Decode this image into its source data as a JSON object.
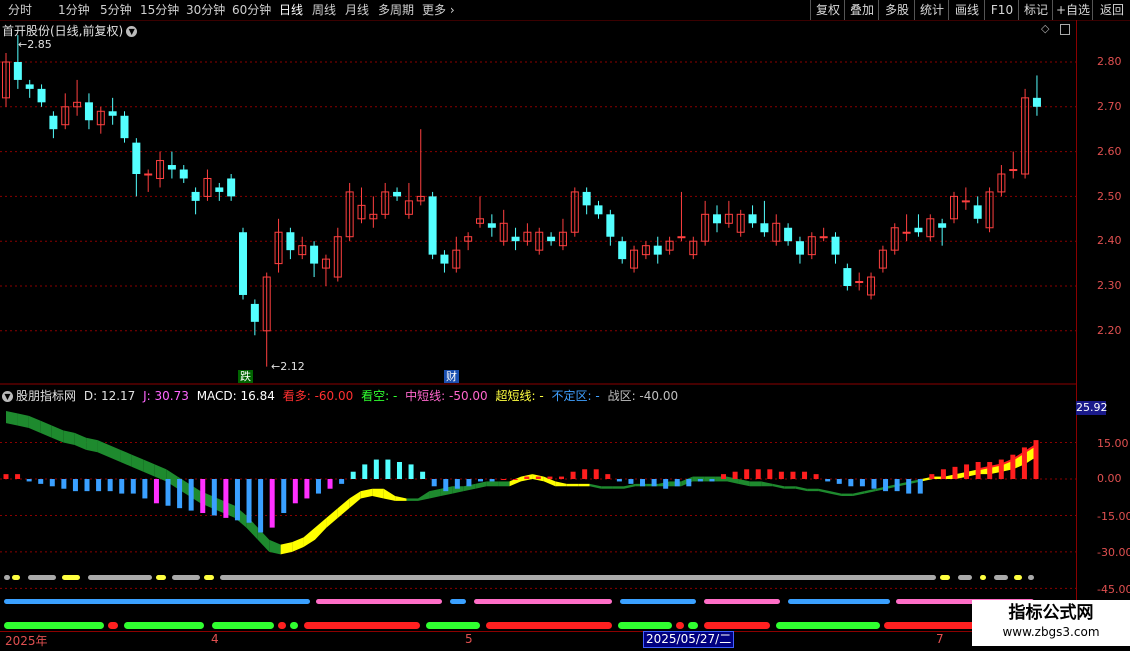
{
  "toolbar": {
    "periods": [
      "分时",
      "1分钟",
      "5分钟",
      "15分钟",
      "30分钟",
      "60分钟",
      "日线",
      "周线",
      "月线",
      "多周期",
      "更多"
    ],
    "active_period": "日线",
    "right_buttons": [
      "复权",
      "叠加",
      "多股",
      "统计",
      "画线",
      "F10",
      "标记",
      "+自选",
      "返回"
    ]
  },
  "chart": {
    "title": "首开股份(日线,前复权)",
    "high_label": "2.85",
    "low_label": "2.12",
    "marker_die": "跌",
    "marker_cai": "财"
  },
  "indicator": {
    "name": "股朋指标网",
    "d": "D: 12.17",
    "j": "J: 30.73",
    "macd": "MACD: 16.84",
    "kanduo": "看多: -60.00",
    "kankong": "看空: -",
    "zhongduan": "中短线: -50.00",
    "chaoduan": "超短线: -",
    "buding": "不定区: -",
    "zhanqu": "战区: -40.00",
    "current_value": "25.92"
  },
  "axis": {
    "price_ticks": [
      "2.80",
      "2.70",
      "2.60",
      "2.50",
      "2.40",
      "2.30",
      "2.20"
    ],
    "ind_ticks": [
      "15.00",
      "0.00",
      "-15.00",
      "-30.00",
      "-45.00"
    ]
  },
  "dates": {
    "labels": [
      "2025年",
      "4",
      "5",
      "7"
    ],
    "selected": "2025/05/27/二"
  },
  "watermark": {
    "line1": "指标公式网",
    "line2": "www.zbgs3.com"
  },
  "colors": {
    "up": "#ff4040",
    "down": "#54ffff",
    "grid": "#8b0000",
    "macd_pos": "#ff1e1e",
    "macd_neg_blue": "#3aa0ff",
    "macd_neg_mag": "#ff30ff",
    "band_green": "#1e8a2e",
    "band_yellow": "#ffff00"
  },
  "chart_data": {
    "type": "candlestick",
    "candles": [
      [
        2.72,
        2.8,
        2.7,
        2.82
      ],
      [
        2.8,
        2.76,
        2.74,
        2.86
      ],
      [
        2.75,
        2.74,
        2.72,
        2.76
      ],
      [
        2.74,
        2.71,
        2.7,
        2.75
      ],
      [
        2.68,
        2.65,
        2.63,
        2.69
      ],
      [
        2.66,
        2.7,
        2.65,
        2.73
      ],
      [
        2.7,
        2.71,
        2.68,
        2.76
      ],
      [
        2.71,
        2.67,
        2.65,
        2.73
      ],
      [
        2.66,
        2.69,
        2.64,
        2.7
      ],
      [
        2.69,
        2.68,
        2.66,
        2.72
      ],
      [
        2.68,
        2.63,
        2.62,
        2.69
      ],
      [
        2.62,
        2.55,
        2.5,
        2.63
      ],
      [
        2.55,
        2.55,
        2.51,
        2.56
      ],
      [
        2.54,
        2.58,
        2.52,
        2.6
      ],
      [
        2.57,
        2.56,
        2.54,
        2.6
      ],
      [
        2.56,
        2.54,
        2.53,
        2.57
      ],
      [
        2.51,
        2.49,
        2.46,
        2.52
      ],
      [
        2.5,
        2.54,
        2.49,
        2.56
      ],
      [
        2.52,
        2.51,
        2.49,
        2.53
      ],
      [
        2.54,
        2.5,
        2.49,
        2.55
      ],
      [
        2.42,
        2.28,
        2.27,
        2.43
      ],
      [
        2.26,
        2.22,
        2.19,
        2.27
      ],
      [
        2.2,
        2.32,
        2.12,
        2.33
      ],
      [
        2.35,
        2.42,
        2.33,
        2.45
      ],
      [
        2.42,
        2.38,
        2.36,
        2.43
      ],
      [
        2.37,
        2.39,
        2.36,
        2.41
      ],
      [
        2.39,
        2.35,
        2.32,
        2.4
      ],
      [
        2.34,
        2.36,
        2.3,
        2.37
      ],
      [
        2.32,
        2.41,
        2.31,
        2.43
      ],
      [
        2.41,
        2.51,
        2.4,
        2.53
      ],
      [
        2.45,
        2.48,
        2.44,
        2.52
      ],
      [
        2.45,
        2.46,
        2.43,
        2.5
      ],
      [
        2.46,
        2.51,
        2.45,
        2.53
      ],
      [
        2.51,
        2.5,
        2.49,
        2.52
      ],
      [
        2.46,
        2.49,
        2.45,
        2.53
      ],
      [
        2.49,
        2.5,
        2.48,
        2.65
      ],
      [
        2.5,
        2.37,
        2.36,
        2.51
      ],
      [
        2.37,
        2.35,
        2.33,
        2.38
      ],
      [
        2.34,
        2.38,
        2.33,
        2.41
      ],
      [
        2.4,
        2.41,
        2.38,
        2.42
      ],
      [
        2.44,
        2.45,
        2.43,
        2.5
      ],
      [
        2.44,
        2.43,
        2.41,
        2.46
      ],
      [
        2.4,
        2.44,
        2.39,
        2.47
      ],
      [
        2.41,
        2.4,
        2.38,
        2.43
      ],
      [
        2.4,
        2.42,
        2.39,
        2.44
      ],
      [
        2.38,
        2.42,
        2.37,
        2.43
      ],
      [
        2.41,
        2.4,
        2.39,
        2.42
      ],
      [
        2.39,
        2.42,
        2.38,
        2.45
      ],
      [
        2.42,
        2.51,
        2.41,
        2.52
      ],
      [
        2.51,
        2.48,
        2.46,
        2.52
      ],
      [
        2.48,
        2.46,
        2.45,
        2.49
      ],
      [
        2.46,
        2.41,
        2.39,
        2.47
      ],
      [
        2.4,
        2.36,
        2.35,
        2.41
      ],
      [
        2.34,
        2.38,
        2.33,
        2.39
      ],
      [
        2.37,
        2.39,
        2.36,
        2.4
      ],
      [
        2.39,
        2.37,
        2.35,
        2.41
      ],
      [
        2.38,
        2.4,
        2.37,
        2.41
      ],
      [
        2.41,
        2.41,
        2.4,
        2.51
      ],
      [
        2.37,
        2.4,
        2.36,
        2.41
      ],
      [
        2.4,
        2.46,
        2.39,
        2.49
      ],
      [
        2.46,
        2.44,
        2.42,
        2.48
      ],
      [
        2.44,
        2.46,
        2.43,
        2.49
      ],
      [
        2.42,
        2.46,
        2.41,
        2.47
      ],
      [
        2.46,
        2.44,
        2.43,
        2.48
      ],
      [
        2.44,
        2.42,
        2.41,
        2.49
      ],
      [
        2.4,
        2.44,
        2.39,
        2.46
      ],
      [
        2.43,
        2.4,
        2.39,
        2.44
      ],
      [
        2.4,
        2.37,
        2.35,
        2.41
      ],
      [
        2.37,
        2.41,
        2.36,
        2.42
      ],
      [
        2.41,
        2.41,
        2.4,
        2.43
      ],
      [
        2.41,
        2.37,
        2.35,
        2.42
      ],
      [
        2.34,
        2.3,
        2.29,
        2.35
      ],
      [
        2.31,
        2.31,
        2.29,
        2.33
      ],
      [
        2.28,
        2.32,
        2.27,
        2.33
      ],
      [
        2.34,
        2.38,
        2.33,
        2.39
      ],
      [
        2.38,
        2.43,
        2.37,
        2.44
      ],
      [
        2.42,
        2.42,
        2.4,
        2.46
      ],
      [
        2.43,
        2.42,
        2.41,
        2.46
      ],
      [
        2.41,
        2.45,
        2.4,
        2.46
      ],
      [
        2.44,
        2.43,
        2.39,
        2.45
      ],
      [
        2.45,
        2.5,
        2.44,
        2.51
      ],
      [
        2.49,
        2.49,
        2.47,
        2.52
      ],
      [
        2.48,
        2.45,
        2.44,
        2.5
      ],
      [
        2.43,
        2.51,
        2.42,
        2.52
      ],
      [
        2.51,
        2.55,
        2.5,
        2.57
      ],
      [
        2.56,
        2.56,
        2.54,
        2.6
      ],
      [
        2.55,
        2.72,
        2.54,
        2.74
      ],
      [
        2.72,
        2.7,
        2.68,
        2.77
      ]
    ],
    "macd": [
      2,
      2,
      -1,
      -2,
      -3,
      -4,
      -5,
      -5,
      -5,
      -5,
      -6,
      -6,
      -8,
      -10,
      -11,
      -12,
      -13,
      -14,
      -15,
      -16,
      -17,
      -18,
      -22,
      -20,
      -14,
      -10,
      -8,
      -6,
      -4,
      -2,
      3,
      6,
      8,
      8,
      7,
      6,
      3,
      -3,
      -5,
      -4,
      -3,
      -1,
      -1,
      0,
      0,
      1,
      1,
      1,
      1,
      3,
      4,
      4,
      2,
      -1,
      -2,
      -3,
      -3,
      -4,
      -3,
      -3,
      -1,
      -1,
      2,
      3,
      4,
      4,
      4,
      3,
      3,
      3,
      2,
      -1,
      -2,
      -3,
      -3,
      -4,
      -5,
      -5,
      -6,
      -6,
      2,
      4,
      5,
      6,
      7,
      7,
      8,
      10,
      13,
      16
    ],
    "band_a": [
      28,
      27,
      26,
      24,
      22,
      20,
      19,
      17,
      16,
      14,
      12,
      10,
      8,
      6,
      4,
      1,
      -2,
      -5,
      -7,
      -9,
      -11,
      -15,
      -20,
      -25,
      -27,
      -26,
      -24,
      -20,
      -16,
      -12,
      -8,
      -5,
      -4,
      -4,
      -7,
      -8,
      -8,
      -5,
      -4,
      -3,
      -3,
      -2,
      -1,
      -1,
      -1,
      1,
      2,
      1,
      -1,
      -2,
      -2,
      -2,
      -3,
      -3,
      -3,
      -2,
      -2,
      -2,
      -1,
      -1,
      1,
      1,
      1,
      1,
      0,
      -1,
      -1,
      -2,
      -3,
      -3,
      -4,
      -4,
      -5,
      -6,
      -6,
      -5,
      -4,
      -3,
      -2,
      -1,
      0,
      1,
      1,
      2,
      3,
      4,
      5,
      6,
      8,
      11,
      14
    ],
    "band_b": [
      23,
      22,
      21,
      19,
      17,
      15,
      14,
      12,
      11,
      9,
      7,
      5,
      3,
      1,
      -1,
      -4,
      -7,
      -10,
      -12,
      -14,
      -16,
      -20,
      -25,
      -30,
      -31,
      -30,
      -28,
      -25,
      -20,
      -16,
      -12,
      -8,
      -7,
      -8,
      -9,
      -9,
      -9,
      -8,
      -7,
      -6,
      -5,
      -4,
      -3,
      -3,
      -3,
      -1,
      0,
      -1,
      -3,
      -3,
      -3,
      -3,
      -4,
      -4,
      -4,
      -3,
      -3,
      -3,
      -3,
      -3,
      -1,
      -1,
      -1,
      -1,
      -2,
      -3,
      -3,
      -3,
      -4,
      -4,
      -5,
      -5,
      -6,
      -7,
      -7,
      -6,
      -5,
      -4,
      -3,
      -2,
      -1,
      0,
      0,
      0,
      1,
      2,
      2,
      3,
      4,
      6,
      9
    ]
  }
}
